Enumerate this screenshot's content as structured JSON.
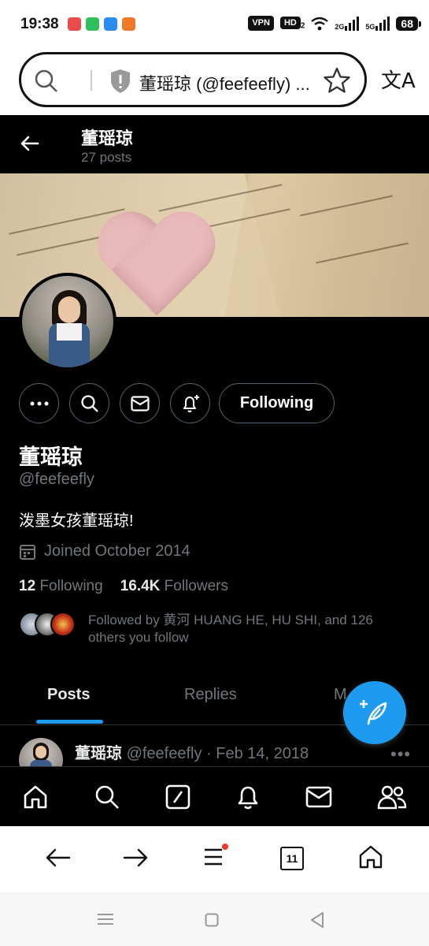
{
  "status_bar": {
    "time": "19:38",
    "vpn": "VPN",
    "hd": "HD",
    "hd_sub": "2",
    "net1": "2G",
    "net2": "5G",
    "battery": "68"
  },
  "browser": {
    "url_title": "董瑶琼 (@feefeefly) ...",
    "tab_count": "11"
  },
  "profile_header": {
    "name": "董瑶琼",
    "post_count": "27 posts"
  },
  "profile": {
    "display_name": "董瑶琼",
    "handle": "@feefeefly",
    "bio": "泼墨女孩董瑶琼!",
    "joined": "Joined October 2014",
    "following_count": "12",
    "following_label": "Following",
    "followers_count": "16.4K",
    "followers_label": "Followers",
    "followed_by": "Followed by 黄河 HUANG HE, HU SHI, and 126 others you follow",
    "following_button": "Following"
  },
  "tabs": [
    {
      "label": "Posts",
      "active": true
    },
    {
      "label": "Replies",
      "active": false
    },
    {
      "label": "M",
      "active": false
    }
  ],
  "tweet": {
    "name": "董瑶琼",
    "handle_date": "@feefeefly · Feb 14, 2018"
  },
  "colors": {
    "accent": "#1d9bf0",
    "background": "#000000",
    "muted": "#71767b"
  }
}
